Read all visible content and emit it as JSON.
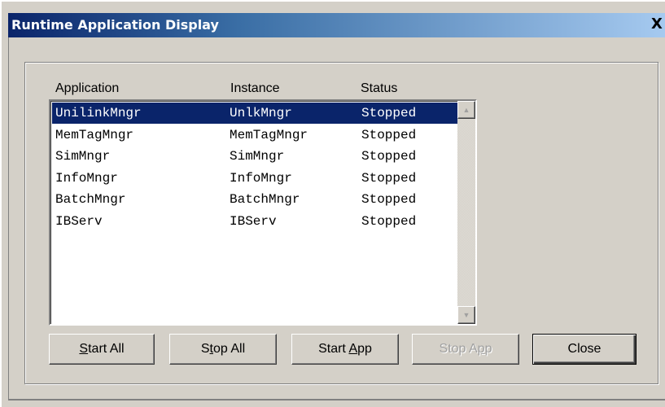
{
  "window": {
    "title": "Runtime Application Display",
    "close_glyph": "X"
  },
  "columns": {
    "application": "Application",
    "instance": "Instance",
    "status": "Status"
  },
  "rows": [
    {
      "application": "UnilinkMngr",
      "instance": "UnlkMngr",
      "status": "Stopped",
      "selected": true
    },
    {
      "application": "MemTagMngr",
      "instance": "MemTagMngr",
      "status": "Stopped",
      "selected": false
    },
    {
      "application": "SimMngr",
      "instance": "SimMngr",
      "status": "Stopped",
      "selected": false
    },
    {
      "application": "InfoMngr",
      "instance": "InfoMngr",
      "status": "Stopped",
      "selected": false
    },
    {
      "application": "BatchMngr",
      "instance": "BatchMngr",
      "status": "Stopped",
      "selected": false
    },
    {
      "application": "IBServ",
      "instance": "IBServ",
      "status": "Stopped",
      "selected": false
    }
  ],
  "scrollbar": {
    "up_glyph": "▲",
    "down_glyph": "▼"
  },
  "buttons": {
    "start_all": {
      "before": "",
      "mnemonic": "S",
      "after": "tart All",
      "enabled": true
    },
    "stop_all": {
      "before": "S",
      "mnemonic": "t",
      "after": "op All",
      "enabled": true
    },
    "start_app": {
      "before": "Start ",
      "mnemonic": "A",
      "after": "pp",
      "enabled": true
    },
    "stop_app": {
      "before": "Stop A",
      "mnemonic": "p",
      "after": "p",
      "enabled": false
    },
    "close": {
      "before": "Close",
      "mnemonic": "",
      "after": "",
      "enabled": true
    }
  },
  "colors": {
    "title_bar_start": "#0a246a",
    "title_bar_end": "#a6caf0",
    "selection": "#0a246a",
    "dialog_face": "#d4d0c8"
  }
}
